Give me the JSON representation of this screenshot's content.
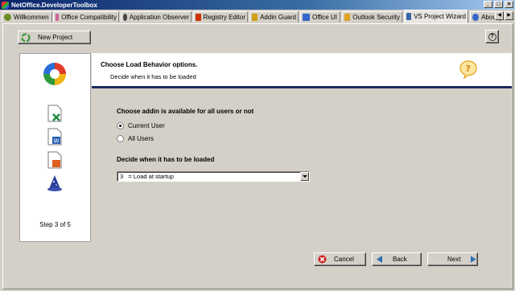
{
  "window": {
    "title": "NetOffice.DeveloperToolbox",
    "controls": {
      "minimize": "_",
      "maximize": "□",
      "close": "×"
    }
  },
  "tabs": [
    {
      "label": "Willkommen",
      "icon": "welcome-icon",
      "color": "#6b8e23"
    },
    {
      "label": "Office Compatibility",
      "icon": "compatibility-icon",
      "color": "#cc6699"
    },
    {
      "label": "Application Observer",
      "icon": "observer-icon",
      "color": "#444444"
    },
    {
      "label": "Registry Editor",
      "icon": "registry-icon",
      "color": "#cc3300"
    },
    {
      "label": "Addin Guard",
      "icon": "guard-icon",
      "color": "#d4a017"
    },
    {
      "label": "Office UI",
      "icon": "office-ui-icon",
      "color": "#3366cc"
    },
    {
      "label": "Outlook Security",
      "icon": "outlook-security-icon",
      "color": "#e0a020"
    },
    {
      "label": "VS Project Wizard",
      "icon": "wizard-icon",
      "color": "#3366aa",
      "active": true
    },
    {
      "label": "About",
      "icon": "about-icon",
      "color": "#3366cc"
    }
  ],
  "toolbar": {
    "new_project_label": "New Project",
    "help_label": "?"
  },
  "steps": {
    "caption": "Step 3 of 5",
    "icons": [
      "office-logo-icon",
      "excel-document-icon",
      "word-document-icon",
      "powerpoint-document-icon",
      "wizard-hat-icon"
    ]
  },
  "header": {
    "title": "Choose Load Behavior options.",
    "subtitle": "Decide when it has to be loaded"
  },
  "form": {
    "availability_label": "Choose addin is available for all users or not",
    "radio_current_user": "Current User",
    "radio_all_users": "All Users",
    "selected_radio": "current_user",
    "load_label": "Decide when it has to be loaded",
    "load_select_value": "3   = Load at startup"
  },
  "buttons": {
    "cancel": "Cancel",
    "back": "Back",
    "next": "Next"
  },
  "colors": {
    "accent_rule": "#1e2a5e",
    "title_bar": "#0a246a",
    "cancel_icon": "#cc2222",
    "nav_arrow": "#2e6eb5"
  }
}
